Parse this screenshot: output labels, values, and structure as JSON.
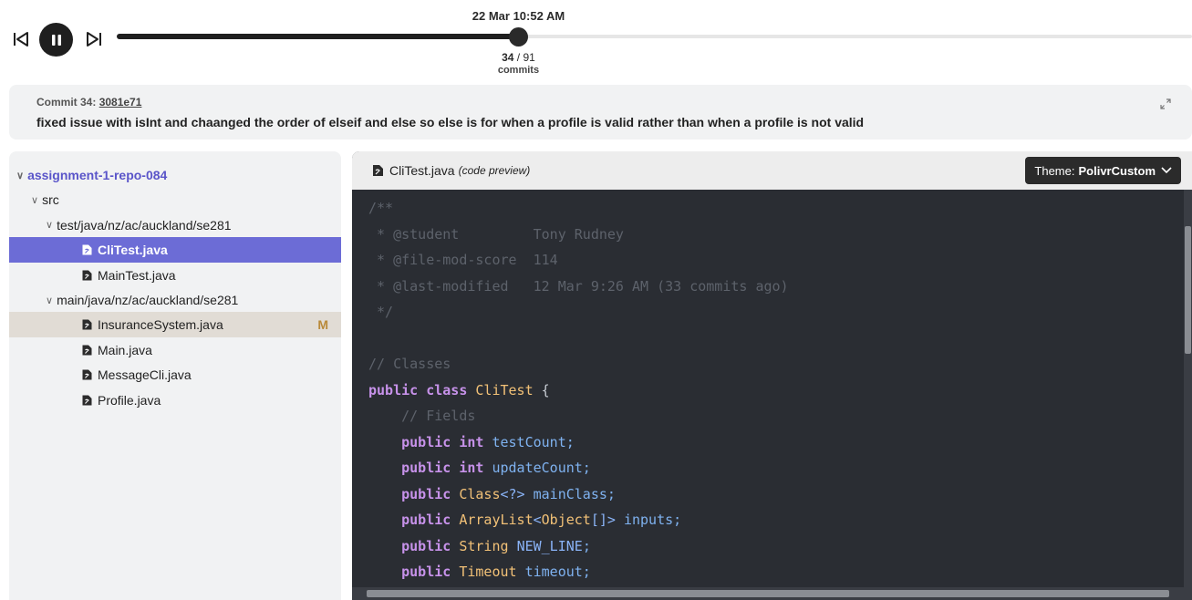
{
  "player": {
    "current_time": "22 Mar 10:52 AM",
    "commit_index": "34",
    "commit_total": "91",
    "commits_label": "commits",
    "progress": 0.3736
  },
  "commit": {
    "prefix": "Commit 34: ",
    "hash": "3081e71",
    "message": "fixed issue with isInt and chaanged the order of elseif and else so else is for when a profile is valid rather than when a profile is not valid"
  },
  "tree": {
    "items": [
      {
        "label": "assignment-1-repo-084",
        "type": "folder",
        "depth": 0,
        "state": "root"
      },
      {
        "label": "src",
        "type": "folder",
        "depth": 1,
        "state": ""
      },
      {
        "label": "test/java/nz/ac/auckland/se281",
        "type": "folder",
        "depth": 2,
        "state": ""
      },
      {
        "label": "CliTest.java",
        "type": "file",
        "depth": 3,
        "state": "selected"
      },
      {
        "label": "MainTest.java",
        "type": "file",
        "depth": 3,
        "state": ""
      },
      {
        "label": "main/java/nz/ac/auckland/se281",
        "type": "folder",
        "depth": 2,
        "state": ""
      },
      {
        "label": "InsuranceSystem.java",
        "type": "file",
        "depth": 3,
        "state": "modified",
        "badge": "M"
      },
      {
        "label": "Main.java",
        "type": "file",
        "depth": 3,
        "state": ""
      },
      {
        "label": "MessageCli.java",
        "type": "file",
        "depth": 3,
        "state": ""
      },
      {
        "label": "Profile.java",
        "type": "file",
        "depth": 3,
        "state": ""
      }
    ]
  },
  "code_panel": {
    "filename": "CliTest.java",
    "preview_label": "(code preview)",
    "theme_prefix": "Theme:",
    "theme_name": "PolivrCustom",
    "lines": [
      [
        {
          "t": "/**",
          "c": "com"
        }
      ],
      [
        {
          "t": " * @student         Tony Rudney",
          "c": "com"
        }
      ],
      [
        {
          "t": " * @file-mod-score  114",
          "c": "com"
        }
      ],
      [
        {
          "t": " * @last-modified   12 Mar 9:26 AM (33 commits ago)",
          "c": "com"
        }
      ],
      [
        {
          "t": " */",
          "c": "com"
        }
      ],
      [
        {
          "t": "",
          "c": "plain"
        }
      ],
      [
        {
          "t": "// Classes",
          "c": "com"
        }
      ],
      [
        {
          "t": "public class ",
          "c": "kw"
        },
        {
          "t": "CliTest",
          "c": "cls"
        },
        {
          "t": " {",
          "c": "plain"
        }
      ],
      [
        {
          "t": "    // Fields",
          "c": "com"
        }
      ],
      [
        {
          "t": "    public int ",
          "c": "kw"
        },
        {
          "t": "testCount;",
          "c": "var"
        }
      ],
      [
        {
          "t": "    public int ",
          "c": "kw"
        },
        {
          "t": "updateCount;",
          "c": "var"
        }
      ],
      [
        {
          "t": "    public ",
          "c": "kw"
        },
        {
          "t": "Class",
          "c": "cls"
        },
        {
          "t": "<?> ",
          "c": "const"
        },
        {
          "t": "mainClass;",
          "c": "var"
        }
      ],
      [
        {
          "t": "    public ",
          "c": "kw"
        },
        {
          "t": "ArrayList",
          "c": "cls"
        },
        {
          "t": "<",
          "c": "const"
        },
        {
          "t": "Object",
          "c": "cls"
        },
        {
          "t": "[]> ",
          "c": "const"
        },
        {
          "t": "inputs;",
          "c": "var"
        }
      ],
      [
        {
          "t": "    public ",
          "c": "kw"
        },
        {
          "t": "String ",
          "c": "cls"
        },
        {
          "t": "NEW_LINE",
          "c": "const"
        },
        {
          "t": ";",
          "c": "var"
        }
      ],
      [
        {
          "t": "    public ",
          "c": "kw"
        },
        {
          "t": "Timeout ",
          "c": "cls"
        },
        {
          "t": "timeout;",
          "c": "var"
        }
      ]
    ]
  },
  "colors": {
    "accent": "#6c6cd6",
    "modified_bg": "#e1dcd5",
    "modified_badge": "#b98a3a",
    "code_bg": "#2a2d33"
  }
}
